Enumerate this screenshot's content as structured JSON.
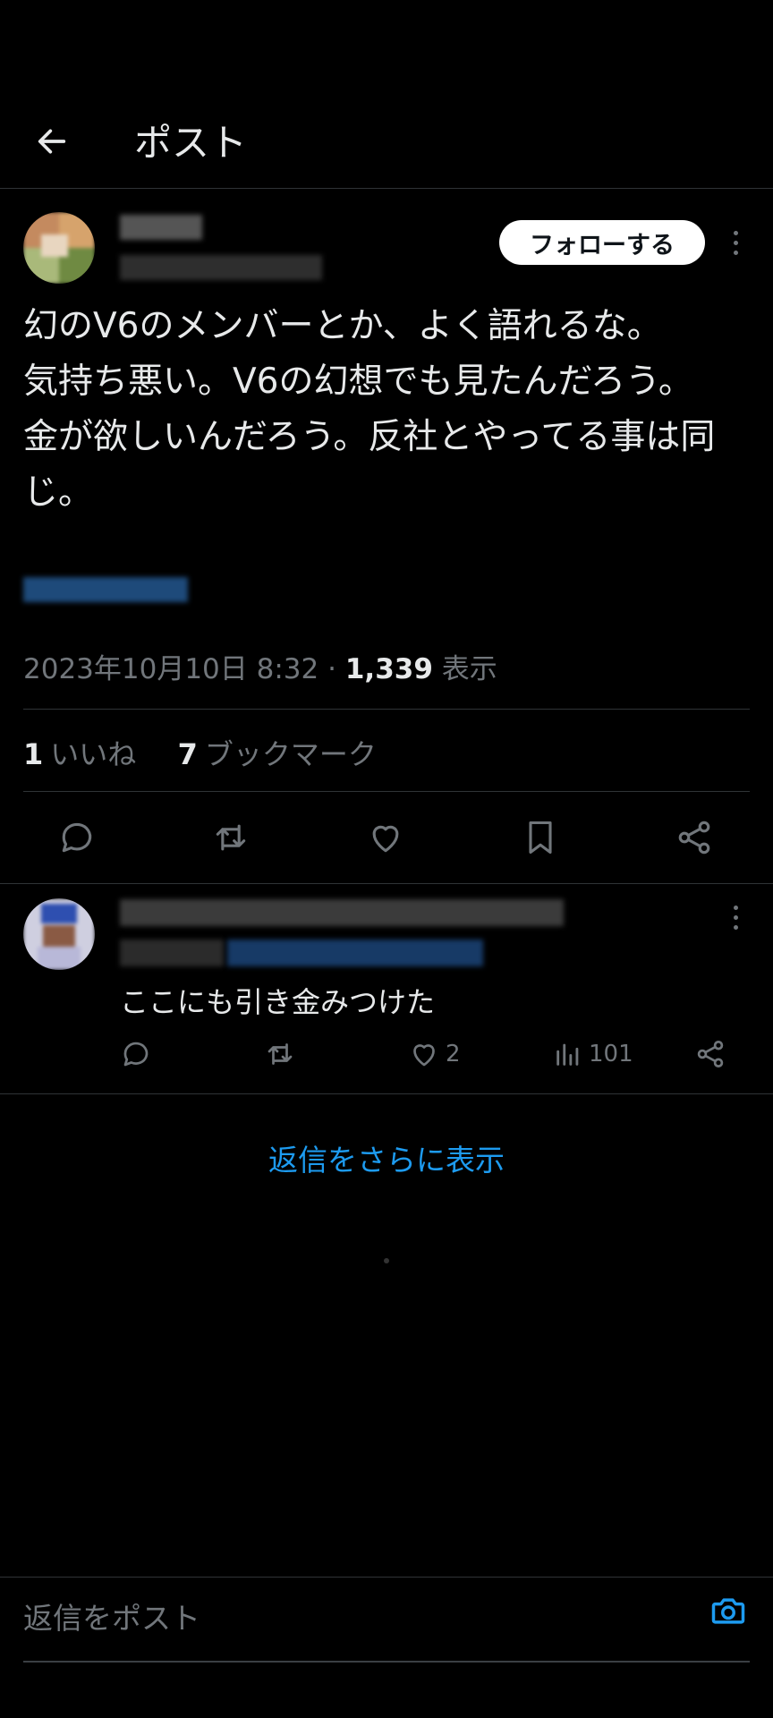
{
  "header": {
    "title": "ポスト"
  },
  "post": {
    "follow_label": "フォローする",
    "text_lines": [
      "幻のV6のメンバーとか、よく語れるな。",
      "気持ち悪い。V6の幻想でも見たんだろう。",
      "金が欲しいんだろう。反社とやってる事は同",
      "じ。"
    ],
    "datetime": "2023年10月10日 8:32",
    "separator": "·",
    "views_count": "1,339",
    "views_label": "表示",
    "likes_count": "1",
    "likes_label": "いいね",
    "bookmarks_count": "7",
    "bookmarks_label": "ブックマーク"
  },
  "reply": {
    "text": "ここにも引き金みつけた",
    "like_count": "2",
    "view_count": "101"
  },
  "more_replies_label": "返信をさらに表示",
  "compose": {
    "placeholder": "返信をポスト"
  },
  "colors": {
    "background": "#000000",
    "accent": "#1d9bf0",
    "muted": "#71767b",
    "text": "#e7e9ea"
  }
}
